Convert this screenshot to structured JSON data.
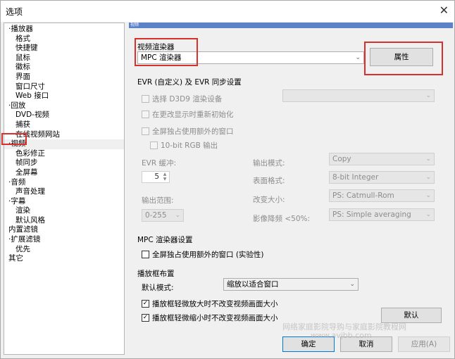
{
  "window": {
    "title": "选项",
    "close_glyph": "✕"
  },
  "panel_header": "视频",
  "tree": [
    {
      "label": "·播放器",
      "level": 0
    },
    {
      "label": "格式",
      "level": 1
    },
    {
      "label": "快捷键",
      "level": 1
    },
    {
      "label": "鼠标",
      "level": 1
    },
    {
      "label": "徽标",
      "level": 1
    },
    {
      "label": "界面",
      "level": 1
    },
    {
      "label": "窗口尺寸",
      "level": 1
    },
    {
      "label": "Web 接口",
      "level": 1
    },
    {
      "label": "·回放",
      "level": 0
    },
    {
      "label": "DVD-视频",
      "level": 1
    },
    {
      "label": "捕获",
      "level": 1
    },
    {
      "label": "在线视频网站",
      "level": 1
    },
    {
      "label": "·视频",
      "level": 0,
      "selected": true
    },
    {
      "label": "色彩修正",
      "level": 1
    },
    {
      "label": "帧同步",
      "level": 1
    },
    {
      "label": "全屏幕",
      "level": 1
    },
    {
      "label": "·音频",
      "level": 0
    },
    {
      "label": "声音处理",
      "level": 1
    },
    {
      "label": "·字幕",
      "level": 0
    },
    {
      "label": "渲染",
      "level": 1
    },
    {
      "label": "默认风格",
      "level": 1
    },
    {
      "label": "内置滤镜",
      "level": 0
    },
    {
      "label": "·扩展滤镜",
      "level": 0
    },
    {
      "label": "优先",
      "level": 1
    },
    {
      "label": "其它",
      "level": 0
    }
  ],
  "renderer": {
    "label": "视频渲染器",
    "value": "MPC 渲染器",
    "properties_button": "属性"
  },
  "evr": {
    "section": "EVR (自定义) 及 EVR 同步设置",
    "select_d3d9": "选择 D3D9 渲染设备",
    "reinit": "在更改显示时重新初始化",
    "fullscreen_extra": "全屏独占使用额外的窗口",
    "rgb10": "10-bit RGB 输出",
    "buffer_label": "EVR 缓冲:",
    "buffer_value": "5",
    "output_range_label": "输出范围:",
    "output_range_value": "0-255",
    "output_mode_label": "输出模式:",
    "output_mode_value": "Copy",
    "surface_label": "表面格式:",
    "surface_value": "8-bit Integer",
    "resize_label": "改变大小:",
    "resize_value": "PS: Catmull-Rom",
    "downscale_label": "影像降频 <50%:",
    "downscale_value": "PS: Simple averaging"
  },
  "mpc": {
    "section": "MPC 渲染器设置",
    "fullscreen_extra": "全屏独占使用额外的窗口 (实验性)"
  },
  "frame": {
    "section": "播放框布置",
    "default_mode_label": "默认模式:",
    "default_mode_value": "缩放以适合窗口",
    "no_change_zoom_in": "播放框轻微放大时不改变视频画面大小",
    "no_change_zoom_out": "播放框轻微缩小时不改变视频画面大小",
    "check_glyph": "✓"
  },
  "buttons": {
    "default": "默认",
    "ok": "确定",
    "cancel": "取消",
    "apply": "应用(A)"
  },
  "watermark": {
    "line1": "网络家庭影院导购与家庭影院教程网",
    "line2": "www.avjbb.com"
  },
  "arrow_glyph": "⌄",
  "spin_glyph_up": "▲",
  "spin_glyph_down": "▼",
  "colors": {
    "highlight_red": "#d9302c",
    "header_blue": "#5b81c7"
  }
}
